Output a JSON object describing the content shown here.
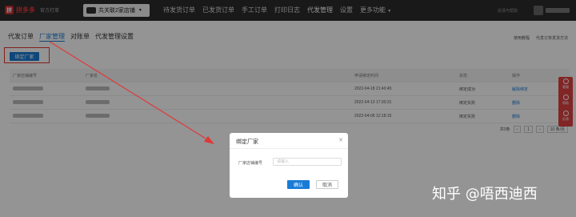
{
  "topbar": {
    "logo_char": "拼",
    "logo_text": "拼多多",
    "logo_sub": "官方打单",
    "shop_name": "共关联2家店铺",
    "nav": [
      "待发货订单",
      "已发货订单",
      "手工订单",
      "打印日志",
      "代发管理",
      "设置",
      "更多功能"
    ],
    "nav_active": "代发管理",
    "help": "反馈与帮助"
  },
  "tabs": [
    {
      "label": "代发订单",
      "active": false
    },
    {
      "label": "厂家管理",
      "active": true
    },
    {
      "label": "对账单",
      "active": false
    },
    {
      "label": "代发管理设置",
      "active": false
    }
  ],
  "tab_links": [
    "使用教程",
    "代发订单发货方法"
  ],
  "bind_button": "绑定厂家",
  "table": {
    "headers": [
      "厂家店铺编号",
      "厂家名",
      "申请绑定时间",
      "状态",
      "操作"
    ],
    "rows": [
      {
        "time": "2022-04-18 21:40:45",
        "status": "绑定成功",
        "action": "解除绑定"
      },
      {
        "time": "2022-04-13 17:30:31",
        "status": "绑定失败",
        "action": "删除"
      },
      {
        "time": "2022-04-06 12:18:15",
        "status": "绑定失败",
        "action": "删除"
      }
    ]
  },
  "pager": {
    "total": "共3条",
    "page": "1",
    "per_page": "10 条/页"
  },
  "float_buttons": [
    "客服",
    "帮助",
    "反馈"
  ],
  "modal": {
    "title": "绑定厂家",
    "close": "✕",
    "field_label": "厂家店铺编号",
    "placeholder": "请输入",
    "ok": "确认",
    "cancel": "取消"
  },
  "watermark": "知乎 @唔西迪西",
  "colors": {
    "accent": "#1a7bd6",
    "brand": "#e03838",
    "annotation": "#e03838"
  }
}
